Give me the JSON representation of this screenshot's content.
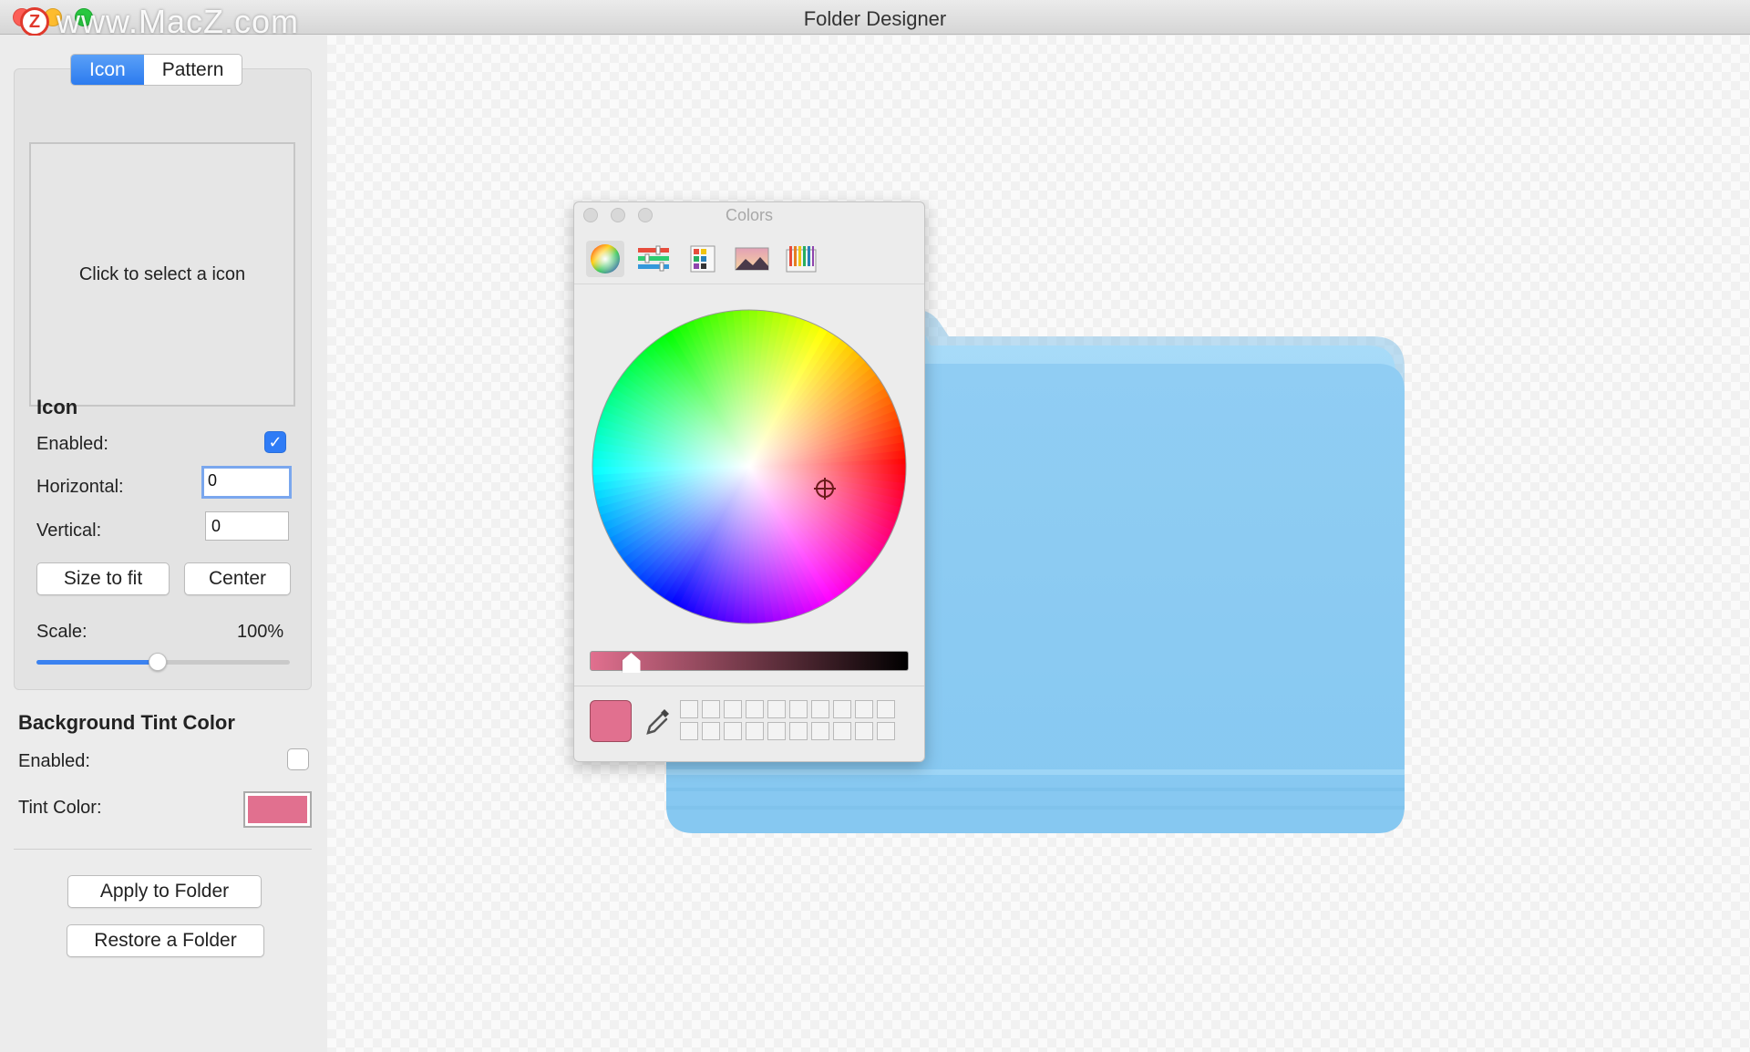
{
  "window": {
    "title": "Folder Designer"
  },
  "watermark": {
    "logo": "Z",
    "text": "www.MacZ.com"
  },
  "sidebar": {
    "tabs": [
      {
        "label": "Icon",
        "active": true
      },
      {
        "label": "Pattern",
        "active": false
      }
    ],
    "icon_dropzone": "Click to select a icon",
    "icon_section": {
      "heading": "Icon",
      "enabled_label": "Enabled:",
      "enabled": true,
      "horizontal_label": "Horizontal:",
      "horizontal_value": "0",
      "vertical_label": "Vertical:",
      "vertical_value": "0",
      "size_to_fit": "Size to fit",
      "center": "Center",
      "scale_label": "Scale:",
      "scale_value": "100%",
      "scale_slider_fraction": 0.48
    },
    "tint_section": {
      "heading": "Background Tint Color",
      "enabled_label": "Enabled:",
      "enabled": false,
      "tint_label": "Tint Color:",
      "tint_color": "#e1708f"
    },
    "apply_button": "Apply to Folder",
    "restore_button": "Restore a Folder"
  },
  "colors_panel": {
    "title": "Colors",
    "modes": [
      "color-wheel-icon",
      "sliders-icon",
      "palettes-icon",
      "image-palette-icon",
      "pencils-icon"
    ],
    "active_mode": "color-wheel-icon",
    "current_color": "#e1708f",
    "brightness_fraction": 0.13,
    "swatch_rows": 2,
    "swatch_cols": 10
  },
  "colors": {
    "accent": "#2f7cf6",
    "folder": "#8ecdf3"
  }
}
